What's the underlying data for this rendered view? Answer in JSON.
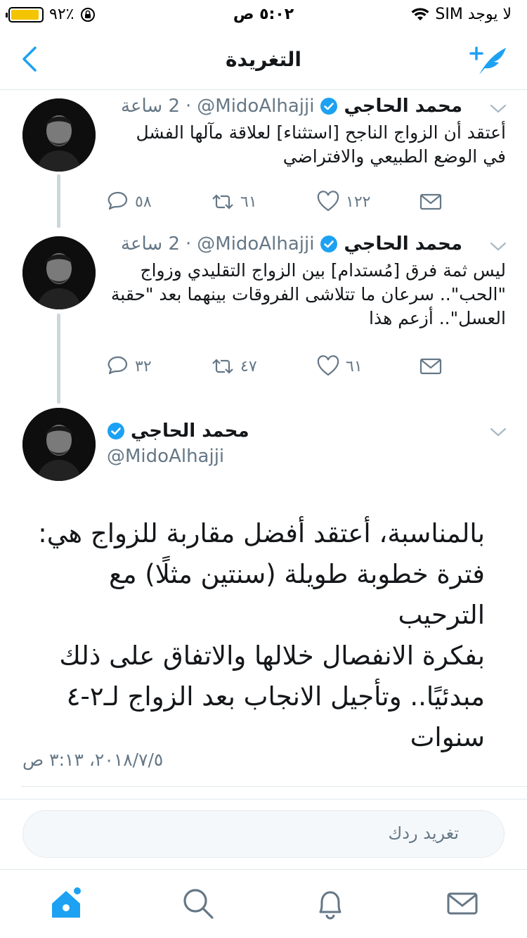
{
  "status_bar": {
    "carrier": "لا يوجد SIM",
    "time": "٥:٠٢ ص",
    "battery": "٩٢٪",
    "battery_level": 0.92
  },
  "nav": {
    "title": "التغريدة"
  },
  "thread": [
    {
      "name": "محمد الحاجي",
      "handle": "@MidoAlhajji",
      "time": "2 ساعة",
      "text_lines": [
        "أعتقد أن الزواج الناجح [استثناء] لعلاقة مآلها الفشل",
        "في الوضع الطبيعي والافتراضي"
      ],
      "replies": "٥٨",
      "retweets": "٦١",
      "likes": "١٢٢"
    },
    {
      "name": "محمد الحاجي",
      "handle": "@MidoAlhajji",
      "time": "2 ساعة",
      "text_lines": [
        "ليس ثمة فرق [مُستدام] بين الزواج التقليدي وزواج",
        "\"الحب\".. سرعان ما تتلاشى الفروقات بينهما بعد \"حقبة",
        "العسل\".. أزعم هذا"
      ],
      "replies": "٣٢",
      "retweets": "٤٧",
      "likes": "٦١"
    }
  ],
  "main_tweet": {
    "name": "محمد الحاجي",
    "handle": "@MidoAlhajji",
    "text_lines": [
      "بالمناسبة، أعتقد أفضل مقاربة للزواج هي:",
      "فترة خطوبة طويلة (سنتين مثلًا) مع الترحيب",
      "بفكرة الانفصال خلالها والاتفاق على ذلك",
      "مبدئيًا.. وتأجيل الانجاب بعد الزواج لـ٢-٤",
      "سنوات"
    ],
    "date": "٢٠١٨/٧/٥، ٣:١٣ ص"
  },
  "reply": {
    "placeholder": "تغريد ردك"
  },
  "tabbar": {
    "items": [
      "home-icon",
      "search-icon",
      "notifications-icon",
      "messages-icon"
    ]
  },
  "colors": {
    "accent": "#1da1f2",
    "text": "#14171a",
    "secondary": "#657786",
    "divider": "#e1e8ed"
  }
}
